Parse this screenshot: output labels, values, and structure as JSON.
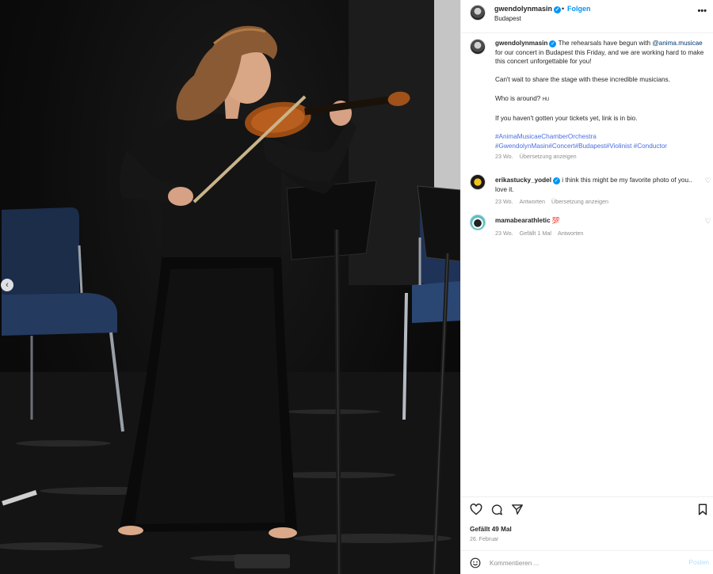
{
  "header": {
    "username": "gwendolynmasin",
    "dot": "•",
    "follow_label": "Folgen",
    "location": "Budapest",
    "more_label": "•••"
  },
  "caption": {
    "username": "gwendolynmasin",
    "line1_a": "The rehearsals have begun with ",
    "mention": "@anima.musicae",
    "line1_b": " for our concert in Budapest this Friday, and we are working hard to make this concert unforgettable for you!",
    "paragraph2": "Can't wait to share the stage with these incredible musicians.",
    "paragraph3": "Who is around? ",
    "paragraph3_flag": "HU",
    "paragraph4": "If you haven't gotten your tickets yet, link is in bio.",
    "hashtags": [
      "#AnimaMusicaeChamberOrchestra",
      "#GwendolynMasin",
      "#Concert",
      "#Budapest",
      "#Violinist",
      "#Conductor"
    ],
    "time": "23 Wo.",
    "translate_label": "Übersetzung anzeigen"
  },
  "comments": [
    {
      "username": "erikastucky_yodel",
      "text": "i think this might be my favorite photo of you.. love it.",
      "time": "23 Wo.",
      "reply_label": "Antworten",
      "translate_label": "Übersetzung anzeigen"
    },
    {
      "username": "mamabearathletic",
      "emoji": "💯",
      "time": "23 Wo.",
      "likes_label": "Gefällt 1 Mal",
      "reply_label": "Antworten"
    }
  ],
  "footer": {
    "likes_text": "Gefällt 49 Mal",
    "date": "26. Februar",
    "comment_placeholder": "Kommentieren ...",
    "post_label": "Posten"
  },
  "photo": {
    "carousel_prev_icon": "chevron-left-icon"
  },
  "colors": {
    "accent": "#0095f6",
    "hashtag": "#4a6ee0",
    "post_disabled": "#b2dffc"
  }
}
